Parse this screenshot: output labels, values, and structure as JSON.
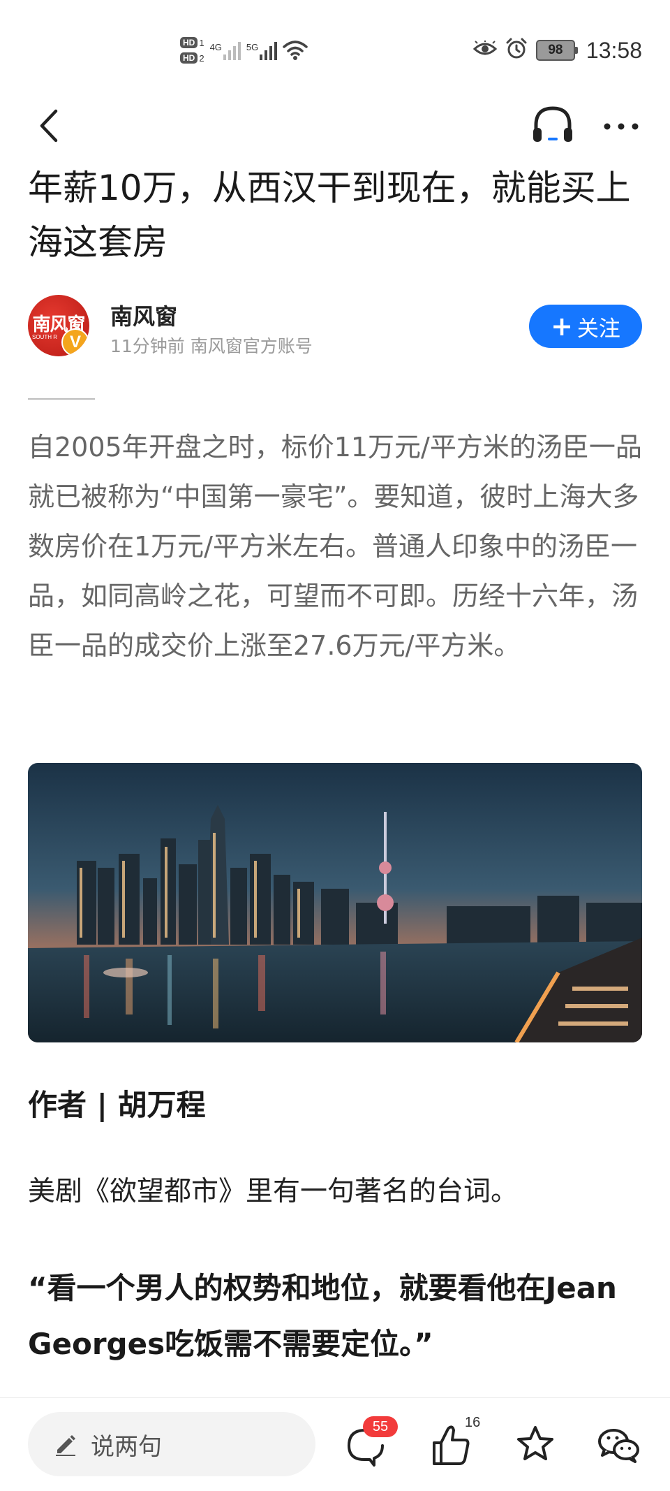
{
  "status_bar": {
    "sim1": "HD",
    "sim1_index": "1",
    "sim2": "HD",
    "sim2_index": "2",
    "network1": "4G",
    "network2": "5G",
    "icons": [
      "eye-comfort-icon",
      "alarm-icon",
      "wifi-icon"
    ],
    "battery": "98",
    "time": "13:58"
  },
  "nav": {
    "icons": [
      "back-icon",
      "headphones-icon",
      "more-icon"
    ]
  },
  "article": {
    "title": "年薪10万，从西汉干到现在，就能买上海这套房",
    "author": {
      "avatar_text": "南风窗",
      "avatar_sub": "SOUTH R",
      "verified_mark": "V",
      "name": "南风窗",
      "meta": "11分钟前 南风窗官方账号",
      "follow_label": "关注"
    },
    "intro": "自2005年开盘之时，标价11万元/平方米的汤臣一品就已被称为“中国第一豪宅”。要知道，彼时上海大多数房价在1万元/平方米左右。普通人印象中的汤臣一品，如同高岭之花，可望而不可即。历经十六年，汤臣一品的成交价上涨至27.6万元/平方米。",
    "byline": "作者 | 胡万程",
    "paragraph": "美剧《欲望都市》里有一句著名的台词。",
    "quote": "“看一个男人的权势和地位，就要看他在Jean Georges吃饭需不需要定位。”"
  },
  "bottom_bar": {
    "comment_placeholder": "说两句",
    "comment_count": "55",
    "like_count": "16",
    "icons": [
      "pencil-icon",
      "comment-icon",
      "thumbs-up-icon",
      "star-icon",
      "wechat-icon"
    ]
  },
  "colors": {
    "accent": "#1677ff",
    "badge": "#f23b3b",
    "intro_text": "#666666",
    "meta_text": "#9a9a9a"
  }
}
